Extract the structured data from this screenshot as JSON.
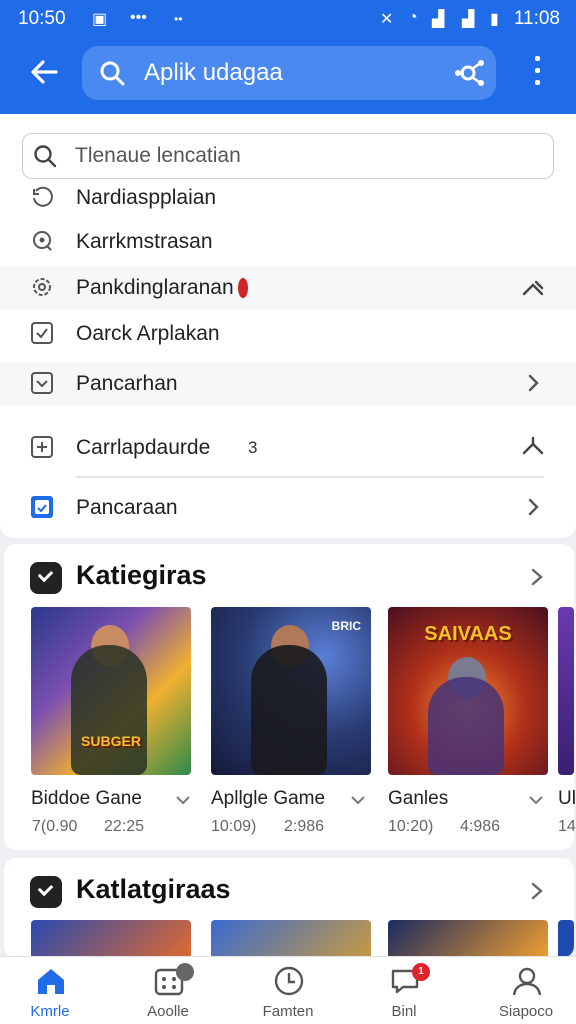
{
  "status_bar": {
    "time": "10:50",
    "right_time": "11:08",
    "dots": "•••"
  },
  "header": {
    "search_text": "Aplik udagaa"
  },
  "dropdown": {
    "search_placeholder": "Tlenaue lencatian",
    "items": [
      {
        "label": "Nardiaspplaian",
        "icon": "history-icon"
      },
      {
        "label": "Karrkmstrasan",
        "icon": "location-pin-icon"
      },
      {
        "label": "Pankdinglaranan",
        "icon": "settings-badge-icon"
      },
      {
        "label": "Oarck Arplakan",
        "icon": "checkbox-icon"
      },
      {
        "label": "Pancarhan",
        "icon": "dropdown-box-icon"
      },
      {
        "label": "Carrlapdaurde",
        "icon": "plus-box-icon",
        "badge": "3"
      },
      {
        "label": "Pancaraan",
        "icon": "app-icon"
      }
    ]
  },
  "categories": [
    {
      "title": "Katiegiras",
      "games": [
        {
          "name": "Biddoe Gane",
          "meta1": "7(0.90",
          "meta2": "22:25",
          "banner": "SUBGER"
        },
        {
          "name": "Apllgle Game",
          "meta1": "10:09)",
          "meta2": "2:986",
          "tag": "BRIC"
        },
        {
          "name": "Ganles",
          "meta1": "10:20)",
          "meta2": "4:986",
          "banner": "SAIVAAS"
        },
        {
          "name": "Ul",
          "meta1": "14",
          "meta2": ""
        }
      ]
    },
    {
      "title": "Katlatgiraas"
    }
  ],
  "bottom_nav": [
    {
      "label": "Kmrle",
      "icon": "home-icon",
      "active": true
    },
    {
      "label": "Aoolle",
      "icon": "apps-icon",
      "badge": ""
    },
    {
      "label": "Famten",
      "icon": "clock-icon"
    },
    {
      "label": "Binl",
      "icon": "chat-icon",
      "badge": "1"
    },
    {
      "label": "Siapoco",
      "icon": "person-icon"
    }
  ],
  "colors": {
    "primary": "#1f6be8",
    "badge_red": "#e0242b"
  }
}
